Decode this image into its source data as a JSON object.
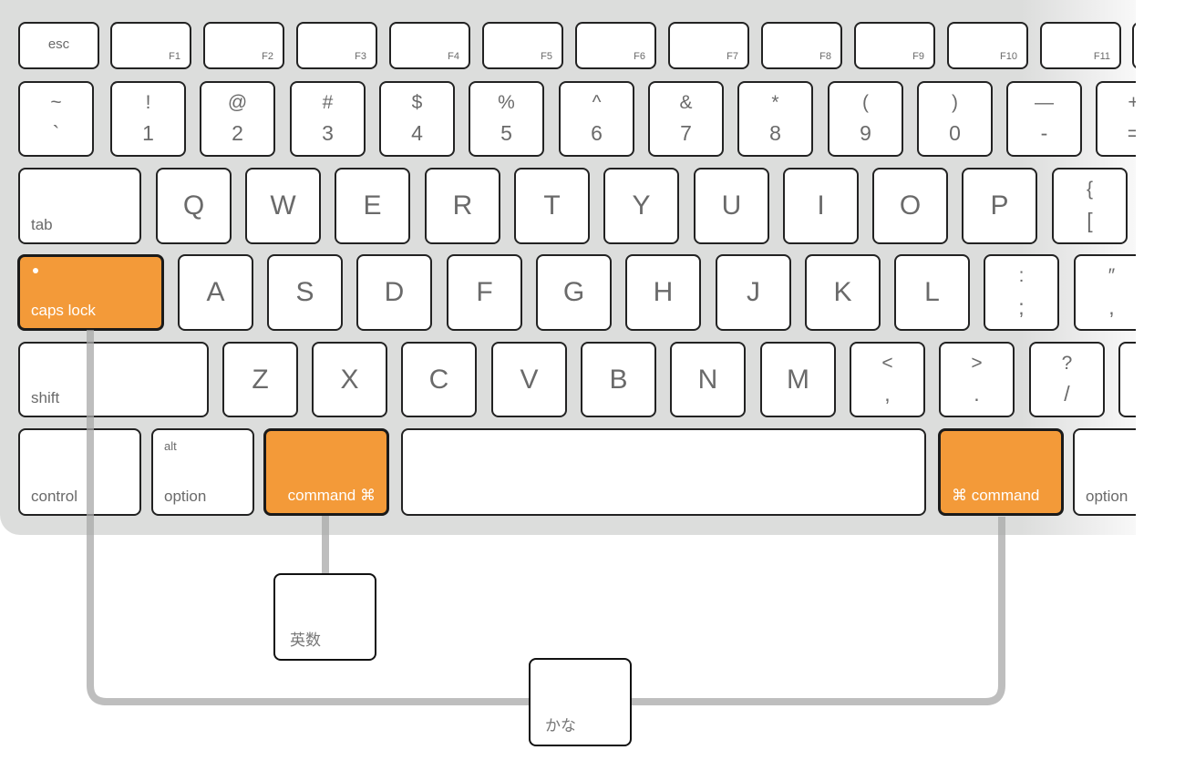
{
  "colors": {
    "highlight": "#f39a39",
    "keyboard": "#dcdddc",
    "connector": "#b4b4b4",
    "key_text": "#6a6a6a"
  },
  "rows": [
    [
      {
        "type": "esc",
        "label": "esc"
      },
      {
        "type": "fn",
        "label": "F1"
      },
      {
        "type": "fn",
        "label": "F2"
      },
      {
        "type": "fn",
        "label": "F3"
      },
      {
        "type": "fn",
        "label": "F4"
      },
      {
        "type": "fn",
        "label": "F5"
      },
      {
        "type": "fn",
        "label": "F6"
      },
      {
        "type": "fn",
        "label": "F7"
      },
      {
        "type": "fn",
        "label": "F8"
      },
      {
        "type": "fn",
        "label": "F9"
      },
      {
        "type": "fn",
        "label": "F10"
      },
      {
        "type": "fn",
        "label": "F11"
      },
      {
        "type": "fn",
        "label": ""
      }
    ],
    [
      {
        "type": "dual",
        "top": "~",
        "bottom": "`"
      },
      {
        "type": "dual",
        "top": "!",
        "bottom": "1"
      },
      {
        "type": "dual",
        "top": "@",
        "bottom": "2"
      },
      {
        "type": "dual",
        "top": "#",
        "bottom": "3"
      },
      {
        "type": "dual",
        "top": "$",
        "bottom": "4"
      },
      {
        "type": "dual",
        "top": "%",
        "bottom": "5"
      },
      {
        "type": "dual",
        "top": "^",
        "bottom": "6"
      },
      {
        "type": "dual",
        "top": "&",
        "bottom": "7"
      },
      {
        "type": "dual",
        "top": "*",
        "bottom": "8"
      },
      {
        "type": "dual",
        "top": "(",
        "bottom": "9"
      },
      {
        "type": "dual",
        "top": ")",
        "bottom": "0"
      },
      {
        "type": "dual",
        "top": "—",
        "bottom": "-"
      },
      {
        "type": "dual",
        "top": "+",
        "bottom": "="
      }
    ],
    [
      {
        "type": "mod",
        "label": "tab"
      },
      {
        "type": "letter",
        "label": "Q"
      },
      {
        "type": "letter",
        "label": "W"
      },
      {
        "type": "letter",
        "label": "E"
      },
      {
        "type": "letter",
        "label": "R"
      },
      {
        "type": "letter",
        "label": "T"
      },
      {
        "type": "letter",
        "label": "Y"
      },
      {
        "type": "letter",
        "label": "U"
      },
      {
        "type": "letter",
        "label": "I"
      },
      {
        "type": "letter",
        "label": "O"
      },
      {
        "type": "letter",
        "label": "P"
      },
      {
        "type": "dual",
        "top": "{",
        "bottom": "["
      }
    ],
    [
      {
        "type": "caps",
        "label": "caps lock",
        "highlight": true
      },
      {
        "type": "letter",
        "label": "A"
      },
      {
        "type": "letter",
        "label": "S"
      },
      {
        "type": "letter",
        "label": "D"
      },
      {
        "type": "letter",
        "label": "F"
      },
      {
        "type": "letter",
        "label": "G"
      },
      {
        "type": "letter",
        "label": "H"
      },
      {
        "type": "letter",
        "label": "J"
      },
      {
        "type": "letter",
        "label": "K"
      },
      {
        "type": "letter",
        "label": "L"
      },
      {
        "type": "dual",
        "top": ":",
        "bottom": ";"
      },
      {
        "type": "dual",
        "top": "″",
        "bottom": ","
      }
    ],
    [
      {
        "type": "mod",
        "label": "shift"
      },
      {
        "type": "letter",
        "label": "Z"
      },
      {
        "type": "letter",
        "label": "X"
      },
      {
        "type": "letter",
        "label": "C"
      },
      {
        "type": "letter",
        "label": "V"
      },
      {
        "type": "letter",
        "label": "B"
      },
      {
        "type": "letter",
        "label": "N"
      },
      {
        "type": "letter",
        "label": "M"
      },
      {
        "type": "dual",
        "top": "<",
        "bottom": ","
      },
      {
        "type": "dual",
        "top": ">",
        "bottom": "."
      },
      {
        "type": "dual",
        "top": "?",
        "bottom": "/"
      },
      {
        "type": "mod",
        "label": ""
      }
    ],
    [
      {
        "type": "mod",
        "label": "control"
      },
      {
        "type": "alt",
        "top": "alt",
        "label": "option"
      },
      {
        "type": "cmdL",
        "label": "command ⌘",
        "highlight": true
      },
      {
        "type": "mod",
        "label": ""
      },
      {
        "type": "cmdR",
        "label": "⌘  command",
        "highlight": true
      },
      {
        "type": "mod",
        "label": "option"
      }
    ]
  ],
  "extra_keys": [
    {
      "label": "英数"
    },
    {
      "label": "かな"
    }
  ]
}
